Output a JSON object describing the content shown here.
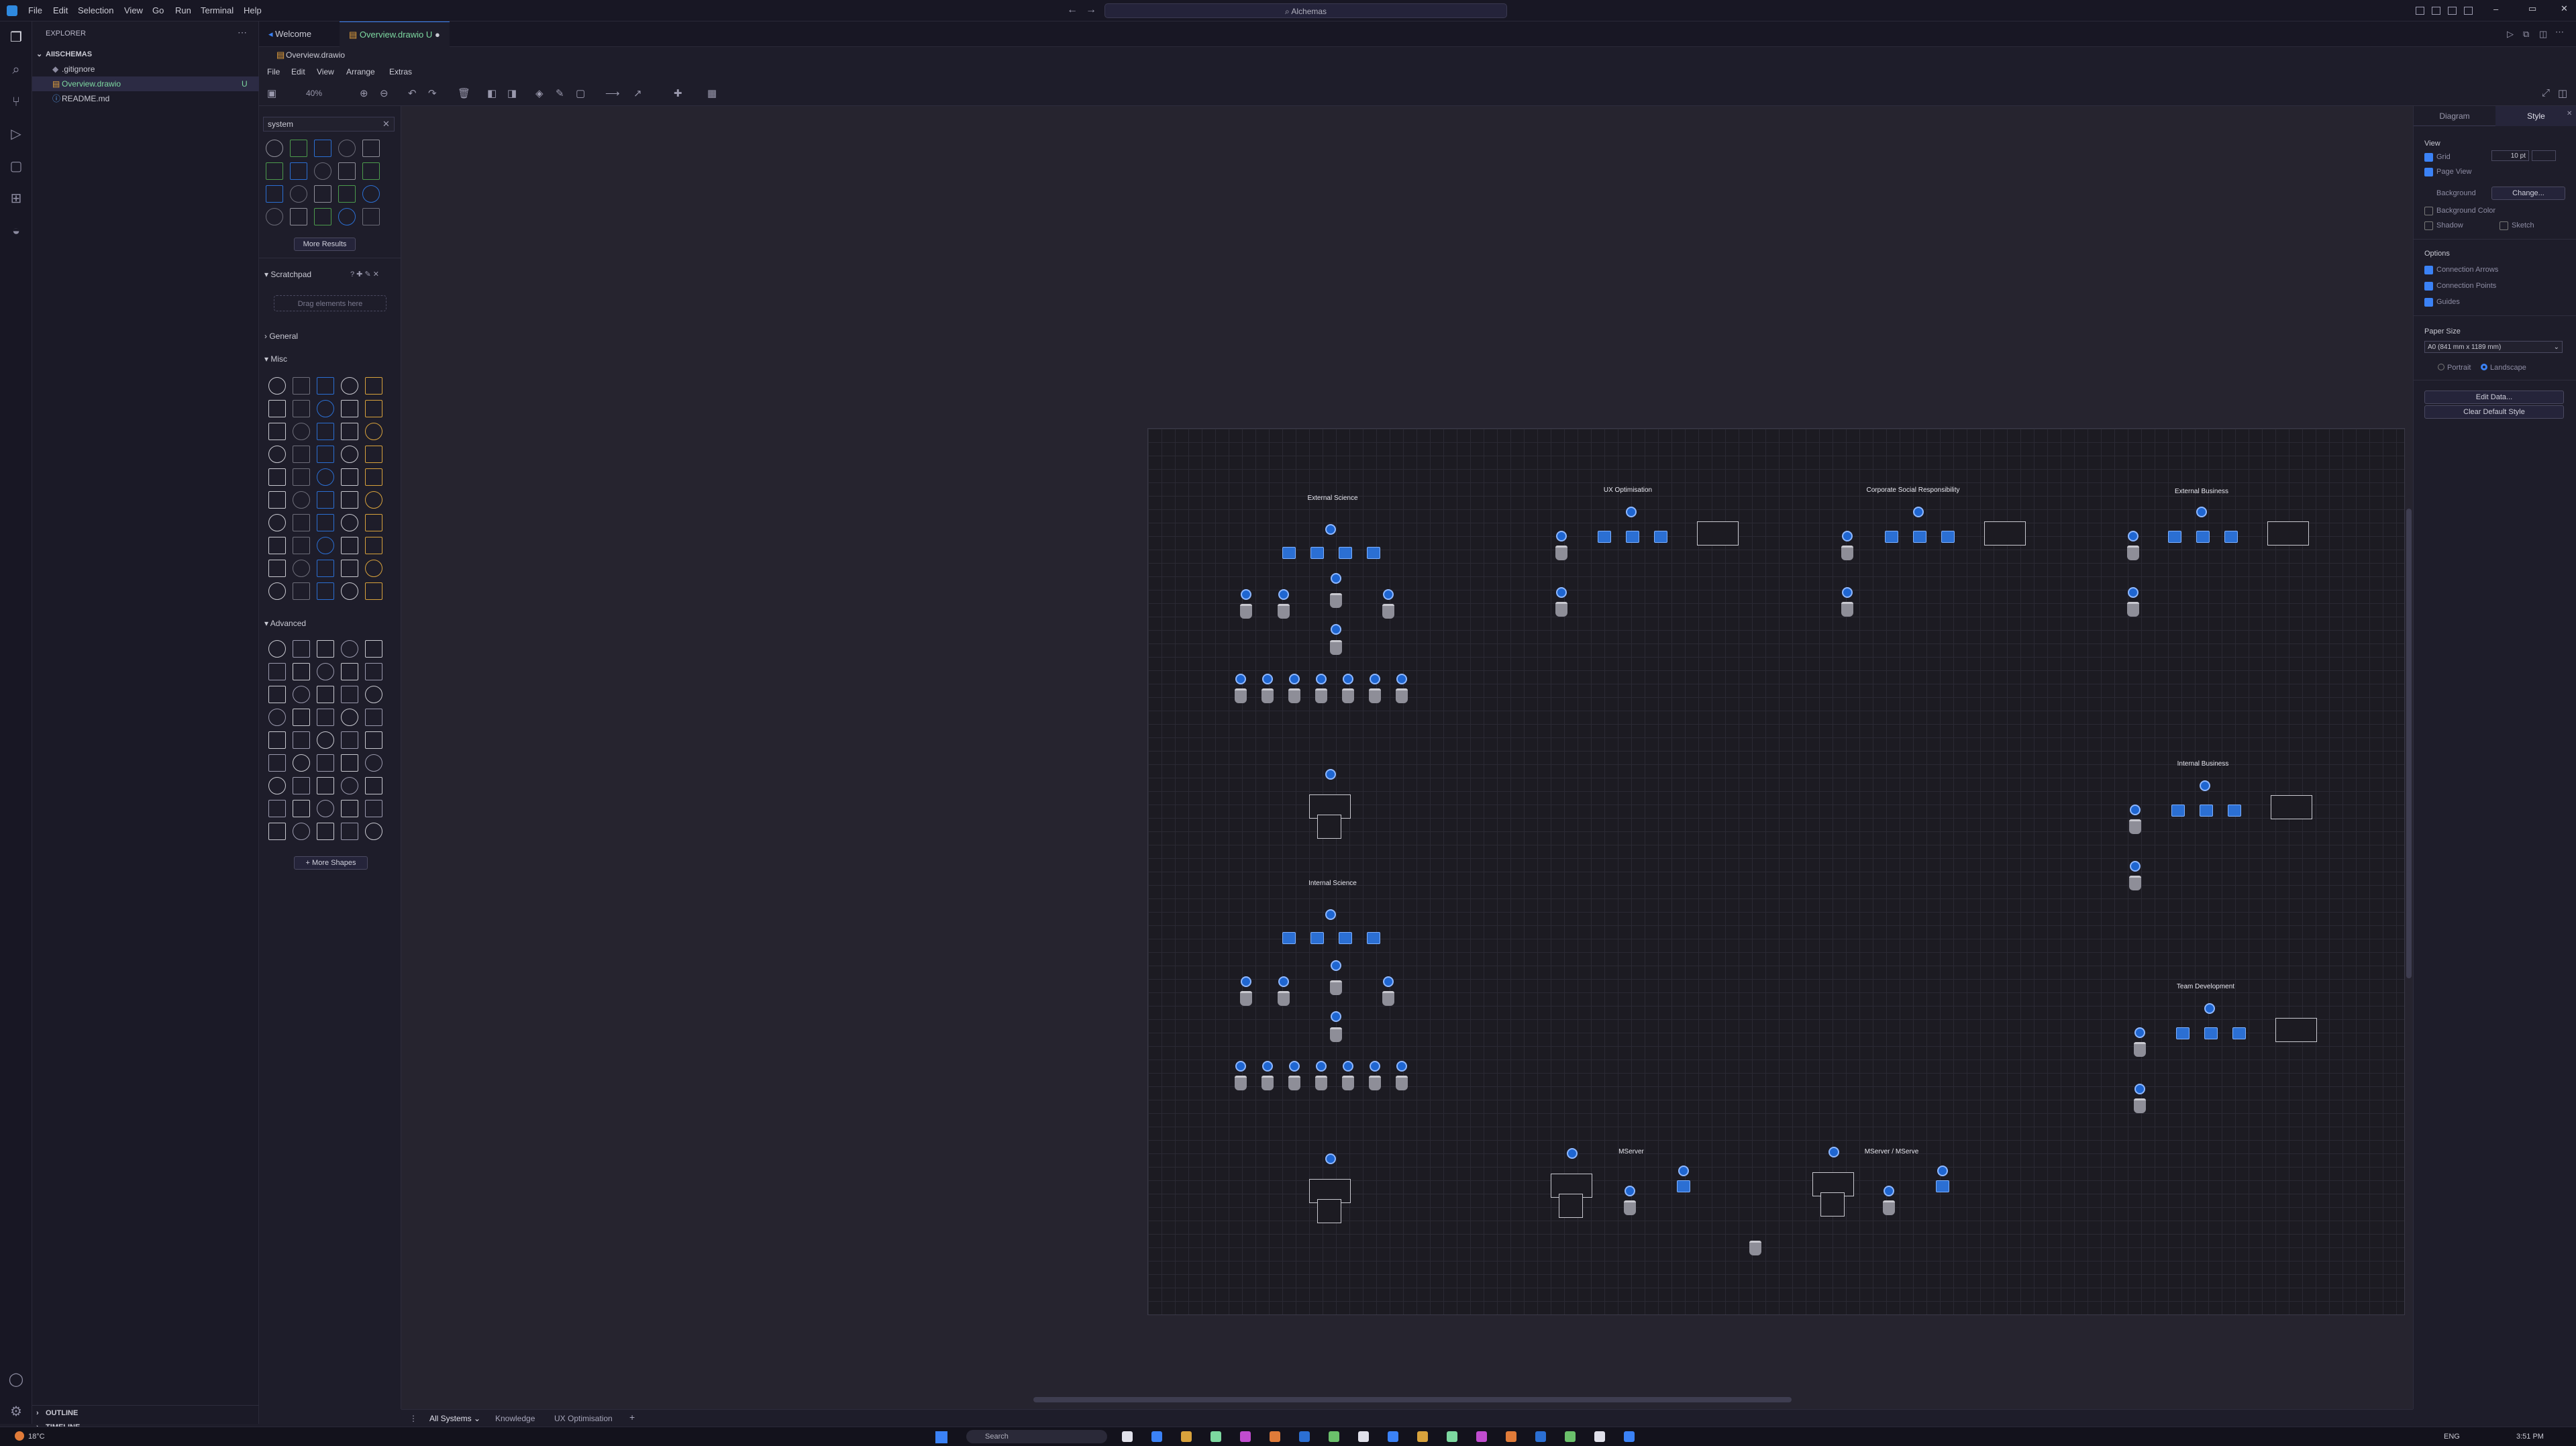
{
  "titlebar": {
    "menu": [
      "File",
      "Edit",
      "Selection",
      "View",
      "Go",
      "Run",
      "Terminal",
      "Help"
    ],
    "search": "Alchemas",
    "back_icon": "arrow-left-icon",
    "forward_icon": "arrow-right-icon"
  },
  "sidebar": {
    "header": "EXPLORER",
    "root": "AIISCHEMAS",
    "files": [
      {
        "name": ".gitignore",
        "status": ""
      },
      {
        "name": "Overview.drawio",
        "status": "U"
      },
      {
        "name": "README.md",
        "status": ""
      }
    ],
    "outline": "OUTLINE",
    "timeline": "TIMELINE"
  },
  "tabs": [
    {
      "label": "Welcome"
    },
    {
      "label": "Overview.drawio",
      "status": "U"
    }
  ],
  "breadcrumb": "Overview.drawio",
  "drawio_menu": [
    "File",
    "Edit",
    "View",
    "Arrange",
    "Extras"
  ],
  "toolbar": {
    "zoom": "40%"
  },
  "shapes_panel": {
    "search_value": "system",
    "more_results": "More Results",
    "scratchpad": "Scratchpad",
    "scratchpad_hint": "Drag elements here",
    "general": "General",
    "misc": "Misc",
    "advanced": "Advanced",
    "more_shapes": "+ More Shapes"
  },
  "format_panel": {
    "tab_diagram": "Diagram",
    "tab_style": "Style",
    "view_header": "View",
    "grid": "Grid",
    "grid_size": "10 pt",
    "page_view": "Page View",
    "background": "Background",
    "change": "Change...",
    "background_color": "Background Color",
    "shadow": "Shadow",
    "sketch": "Sketch",
    "options_header": "Options",
    "connection_arrows": "Connection Arrows",
    "connection_points": "Connection Points",
    "guides": "Guides",
    "paper_size_header": "Paper Size",
    "paper_size": "A0 (841 mm x 1189 mm)",
    "portrait": "Portrait",
    "landscape": "Landscape",
    "edit_data": "Edit Data...",
    "clear_default_style": "Clear Default Style"
  },
  "diagram": {
    "groups": [
      "External Science",
      "UX Optimisation",
      "Corporate Social Responsibility",
      "External Business",
      "Internal Business",
      "Internal Science",
      "Team Development",
      "MServer",
      "MServer / MServe"
    ]
  },
  "page_tabs": [
    "All Systems",
    "Knowledge",
    "UX Optimisation"
  ],
  "taskbar": {
    "weather": "18°C",
    "search": "Search",
    "language": "ENG",
    "time": "3:51 PM"
  }
}
